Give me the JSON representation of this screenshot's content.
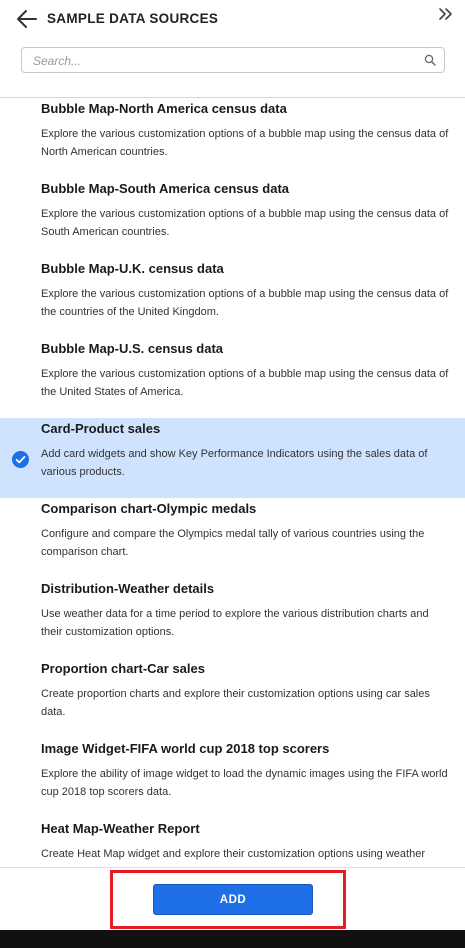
{
  "header": {
    "title": "SAMPLE DATA SOURCES"
  },
  "search": {
    "placeholder": "Search..."
  },
  "items": [
    {
      "title": "Bubble Map-North America census data",
      "description": "Explore the various customization options of a bubble map using the census data of North American countries.",
      "selected": false
    },
    {
      "title": "Bubble Map-South America census data",
      "description": "Explore the various customization options of a bubble map using the census data of South American countries.",
      "selected": false
    },
    {
      "title": "Bubble Map-U.K. census data",
      "description": "Explore the various customization options of a bubble map using the census data of the countries of the United Kingdom.",
      "selected": false
    },
    {
      "title": "Bubble Map-U.S. census data",
      "description": "Explore the various customization options of a bubble map using the census data of the United States of America.",
      "selected": false
    },
    {
      "title": "Card-Product sales",
      "description": "Add card widgets and show Key Performance Indicators using the sales data of various products.",
      "selected": true
    },
    {
      "title": "Comparison chart-Olympic medals",
      "description": "Configure and compare the Olympics medal tally of various countries using the comparison chart.",
      "selected": false
    },
    {
      "title": "Distribution-Weather details",
      "description": "Use weather data for a time period to explore the various distribution charts and their customization options.",
      "selected": false
    },
    {
      "title": "Proportion chart-Car sales",
      "description": "Create proportion charts and explore their customization options using car sales data.",
      "selected": false
    },
    {
      "title": "Image Widget-FIFA world cup 2018 top scorers",
      "description": "Explore the ability of image widget to load the dynamic images using the FIFA world cup 2018 top scorers data.",
      "selected": false
    },
    {
      "title": "Heat Map-Weather Report",
      "description": "Create Heat Map widget and explore their customization options using weather report data.",
      "selected": false
    }
  ],
  "footer": {
    "add_label": "ADD"
  },
  "colors": {
    "accent": "#1e6fe8",
    "selected_bg": "#cfe3ff",
    "highlight_border": "#e11b22"
  },
  "icons": {
    "back": "arrow-left-icon",
    "collapse": "double-chevron-right-icon",
    "search": "search-icon",
    "check": "check-circle-icon"
  }
}
